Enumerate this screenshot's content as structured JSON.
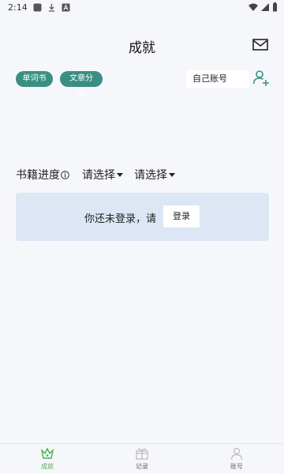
{
  "status_bar": {
    "time": "2:14",
    "icons": [
      "notification-square-icon",
      "download-icon",
      "app-a-icon",
      "wifi-icon",
      "signal-icon",
      "battery-icon"
    ]
  },
  "header": {
    "title": "成就",
    "mail_icon": "mail-icon"
  },
  "filters": {
    "chip_vocab": "单词书",
    "chip_article": "文章分类",
    "account_placeholder": "自己账号",
    "add_user_icon": "add-user-icon",
    "accent": "#3a8f83"
  },
  "progress": {
    "label": "书籍进度",
    "info_icon": "info-icon",
    "select1": "请选择",
    "select2": "请选择"
  },
  "login_card": {
    "message": "你还未登录，请",
    "button": "登录",
    "background": "#dce6f5"
  },
  "bottom_nav": [
    {
      "label": "成就",
      "icon": "achievement-crown-icon",
      "active": true
    },
    {
      "label": "记录",
      "icon": "gift-record-icon",
      "active": false
    },
    {
      "label": "账号",
      "icon": "account-person-icon",
      "active": false
    }
  ],
  "colors": {
    "active": "#4caf50",
    "inactive": "#9a9a9a"
  }
}
